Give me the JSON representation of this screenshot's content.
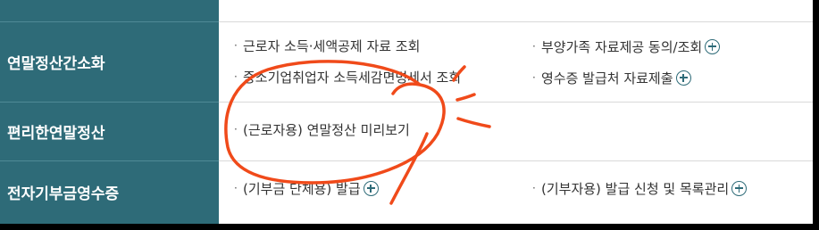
{
  "categories": [
    {
      "label": "연말정산간소화"
    },
    {
      "label": "편리한연말정산"
    },
    {
      "label": "전자기부금영수증"
    }
  ],
  "rows": {
    "row1": {
      "left_top": {
        "label": "근로자 소득·세액공제 자료 조회"
      },
      "right_top": {
        "label": "부양가족 자료제공 동의/조회"
      },
      "left_bottom": {
        "label": "중소기업취업자 소득세감면명세서 조회"
      },
      "right_bottom": {
        "label": "영수증 발급처 자료제출"
      }
    },
    "row2": {
      "left": {
        "label": "(근로자용) 연말정산 미리보기"
      }
    },
    "row3": {
      "left": {
        "label": "(기부금 단체용) 발급"
      },
      "right": {
        "label": "(기부자용) 발급 신청 및 목록관리"
      }
    }
  },
  "bullet": "·",
  "colors": {
    "sidebar": "#2e6b78",
    "annotation": "#f04a1a",
    "plus_icon": "#2e6b78"
  }
}
